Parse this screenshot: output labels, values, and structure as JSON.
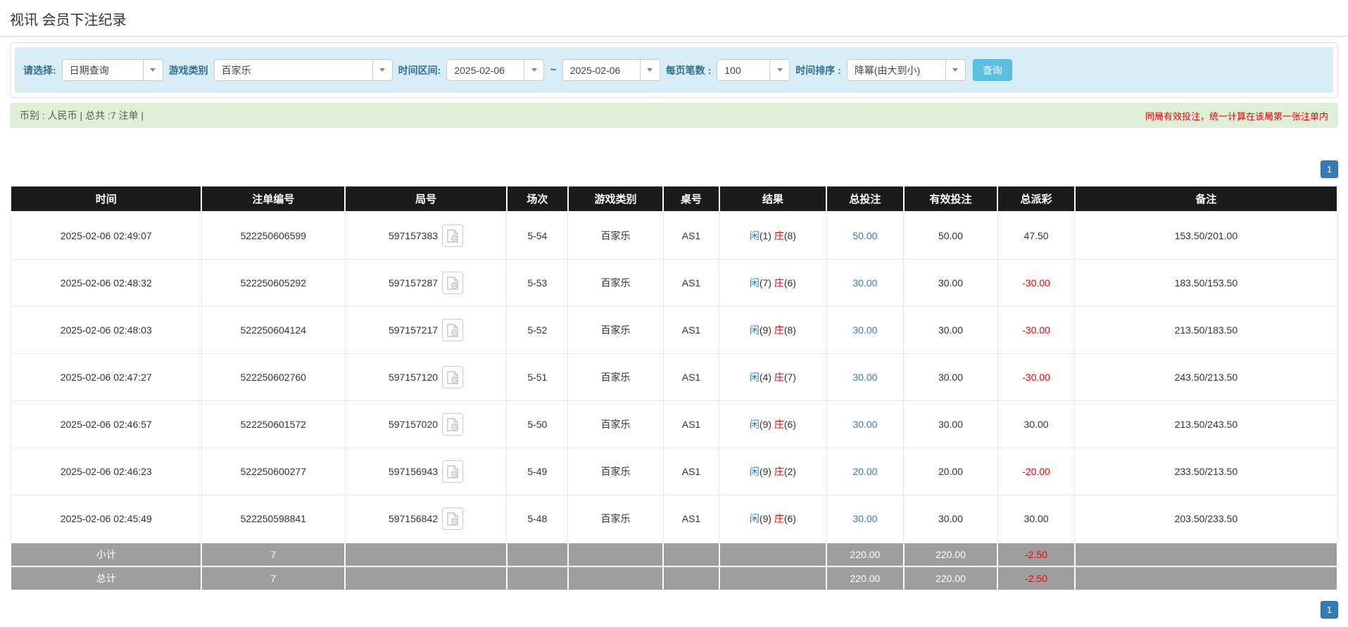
{
  "page": {
    "title": "视讯 会员下注纪录"
  },
  "filters": {
    "select_label": "请选择:",
    "select_value": "日期查询",
    "game_type_label": "游戏类别",
    "game_type_value": "百家乐",
    "time_range_label": "时间区间:",
    "date_from": "2025-02-06",
    "tilde": "~",
    "date_to": "2025-02-06",
    "page_size_label": "每页笔数 :",
    "page_size_value": "100",
    "sort_label": "时间排序 :",
    "sort_value": "降幂(由大到小)",
    "search_button": "查询"
  },
  "summary_bar": {
    "left_text": "币别 : 人民币 | 总共 :7 注单 |",
    "right_text": "同局有效投注，统一计算在该局第一张注单内"
  },
  "pagination": {
    "page": "1"
  },
  "icons": {
    "dropdown_caret": "caret-down",
    "round_icon": "video-file"
  },
  "colors": {
    "accent_info": "#5bc0de",
    "filter_bg": "#d9edf7",
    "alert_bg": "#dff0d8",
    "header_bg": "#1b1b1b",
    "summary_row_bg": "#9e9e9e",
    "link_blue": "#337ab7",
    "negative_red": "#f20000"
  },
  "table": {
    "headers": [
      "时间",
      "注单编号",
      "局号",
      "场次",
      "游戏类别",
      "桌号",
      "结果",
      "总投注",
      "有效投注",
      "总派彩",
      "备注"
    ],
    "rows": [
      {
        "time": "2025-02-06 02:49:07",
        "bet_id": "522250606599",
        "round_id": "597157383",
        "session": "5-54",
        "game": "百家乐",
        "table_no": "AS1",
        "p_label": "闲",
        "p_value": "(1)",
        "b_label": "庄",
        "b_value": "(8)",
        "total_bet": "50.00",
        "valid_bet": "50.00",
        "payout": "47.50",
        "remark": "153.50/201.00"
      },
      {
        "time": "2025-02-06 02:48:32",
        "bet_id": "522250605292",
        "round_id": "597157287",
        "session": "5-53",
        "game": "百家乐",
        "table_no": "AS1",
        "p_label": "闲",
        "p_value": "(7)",
        "b_label": "庄",
        "b_value": "(6)",
        "total_bet": "30.00",
        "valid_bet": "30.00",
        "payout": "-30.00",
        "remark": "183.50/153.50"
      },
      {
        "time": "2025-02-06 02:48:03",
        "bet_id": "522250604124",
        "round_id": "597157217",
        "session": "5-52",
        "game": "百家乐",
        "table_no": "AS1",
        "p_label": "闲",
        "p_value": "(9)",
        "b_label": "庄",
        "b_value": "(8)",
        "total_bet": "30.00",
        "valid_bet": "30.00",
        "payout": "-30.00",
        "remark": "213.50/183.50"
      },
      {
        "time": "2025-02-06 02:47:27",
        "bet_id": "522250602760",
        "round_id": "597157120",
        "session": "5-51",
        "game": "百家乐",
        "table_no": "AS1",
        "p_label": "闲",
        "p_value": "(4)",
        "b_label": "庄",
        "b_value": "(7)",
        "total_bet": "30.00",
        "valid_bet": "30.00",
        "payout": "-30.00",
        "remark": "243.50/213.50"
      },
      {
        "time": "2025-02-06 02:46:57",
        "bet_id": "522250601572",
        "round_id": "597157020",
        "session": "5-50",
        "game": "百家乐",
        "table_no": "AS1",
        "p_label": "闲",
        "p_value": "(9)",
        "b_label": "庄",
        "b_value": "(6)",
        "total_bet": "30.00",
        "valid_bet": "30.00",
        "payout": "30.00",
        "remark": "213.50/243.50"
      },
      {
        "time": "2025-02-06 02:46:23",
        "bet_id": "522250600277",
        "round_id": "597156943",
        "session": "5-49",
        "game": "百家乐",
        "table_no": "AS1",
        "p_label": "闲",
        "p_value": "(9)",
        "b_label": "庄",
        "b_value": "(2)",
        "total_bet": "20.00",
        "valid_bet": "20.00",
        "payout": "-20.00",
        "remark": "233.50/213.50"
      },
      {
        "time": "2025-02-06 02:45:49",
        "bet_id": "522250598841",
        "round_id": "597156842",
        "session": "5-48",
        "game": "百家乐",
        "table_no": "AS1",
        "p_label": "闲",
        "p_value": "(9)",
        "b_label": "庄",
        "b_value": "(6)",
        "total_bet": "30.00",
        "valid_bet": "30.00",
        "payout": "30.00",
        "remark": "203.50/233.50"
      }
    ],
    "subtotal": {
      "label": "小计",
      "count": "7",
      "total_bet": "220.00",
      "valid_bet": "220.00",
      "payout": "-2.50"
    },
    "total": {
      "label": "总计",
      "count": "7",
      "total_bet": "220.00",
      "valid_bet": "220.00",
      "payout": "-2.50"
    }
  }
}
